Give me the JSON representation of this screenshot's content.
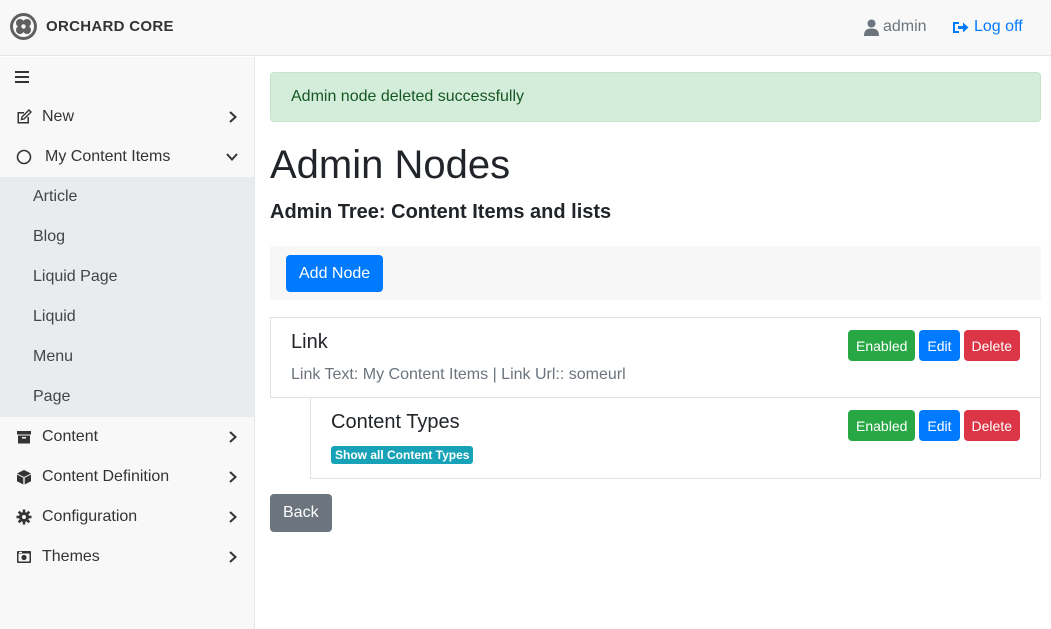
{
  "header": {
    "brand": "ORCHARD CORE",
    "user": "admin",
    "logoff": "Log off"
  },
  "sidebar": {
    "items": [
      {
        "label": "New",
        "icon": "edit-icon"
      },
      {
        "label": "My Content Items",
        "icon": "circle-icon"
      },
      {
        "label": "Content",
        "icon": "archive-icon"
      },
      {
        "label": "Content Definition",
        "icon": "cube-icon"
      },
      {
        "label": "Configuration",
        "icon": "gear-icon"
      },
      {
        "label": "Themes",
        "icon": "image-icon"
      }
    ],
    "subitems": [
      "Article",
      "Blog",
      "Liquid Page",
      "Liquid",
      "Menu",
      "Page"
    ]
  },
  "main": {
    "alert": "Admin node deleted successfully",
    "title": "Admin Nodes",
    "subtitle": "Admin Tree: Content Items and lists",
    "add_node": "Add Node",
    "back": "Back",
    "nodes": [
      {
        "title": "Link",
        "description": "Link Text: My Content Items | Link Url:: someurl",
        "enabled": "Enabled",
        "edit": "Edit",
        "delete": "Delete"
      },
      {
        "title": "Content Types",
        "badge": "Show all Content Types",
        "enabled": "Enabled",
        "edit": "Edit",
        "delete": "Delete"
      }
    ]
  },
  "colors": {
    "primary": "#007bff",
    "success": "#28a745",
    "danger": "#dc3545",
    "secondary": "#6c757d",
    "info": "#17a2b8",
    "alert_bg": "#d4edda"
  }
}
